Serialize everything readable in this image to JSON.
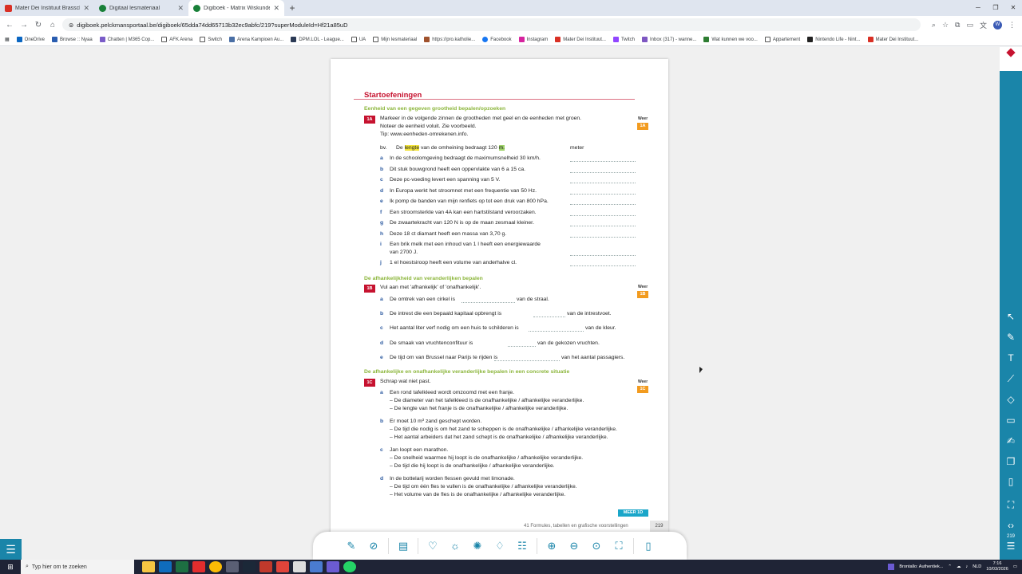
{
  "browser": {
    "tabs": [
      {
        "title": "Mater Dei Instituut Brasschaat",
        "color": "#d93025"
      },
      {
        "title": "Digitaal lesmateriaal",
        "color": "#188038"
      },
      {
        "title": "Digiboek - Matrix Wiskunde 3-4",
        "color": "#188038"
      }
    ],
    "url": "digiboek.pelckmansportaal.be/digiboek/65dda74dd65713b32ec9abfc/219?superModuleId=Hf21a85uD",
    "bookmarks": [
      "OneDrive",
      "Browse :: Nyaa",
      "Chatten | M365 Cop...",
      "AFK Arena",
      "Switch",
      "Arena Kampioen Au...",
      "DPM.LOL - League...",
      "UA",
      "Mijn lesmateriaal",
      "https://pro.katholie...",
      "Facebook",
      "Instagram",
      "Mater Dei Instituut...",
      "Twitch",
      "Inbox (317) - wanne...",
      "Wat kunnen we voo...",
      "Appartement",
      "Nintendo Life - Nint...",
      "Mater Dei Instituut..."
    ]
  },
  "doc": {
    "title": "Startoefeningen",
    "sectionA": "Eenheid van een gegeven grootheid bepalen/opzoeken",
    "tagA": "1A",
    "instrA": [
      "Markeer in de volgende zinnen de grootheden met geel en de eenheden met groen.",
      "Noteer de eenheid voluit. Zie voorbeeld.",
      "Tip: www.eenheden-omrekenen.info."
    ],
    "example": {
      "label": "bv.",
      "pre": "De ",
      "hl": "lengte",
      "mid": " van de omheining bedraagt 120 ",
      "unit": "m.",
      "answer": "meter"
    },
    "itemsA": [
      {
        "l": "a",
        "t": "In de schoolomgeving bedraagt de maximumsnelheid 30 km/h."
      },
      {
        "l": "b",
        "t": "Dit stuk bouwgrond heeft een oppervlakte van 6 a 15 ca."
      },
      {
        "l": "c",
        "t": "Deze pc-voeding levert een spanning van 5 V."
      },
      {
        "l": "d",
        "t": "In Europa werkt het stroomnet met een frequentie van 50 Hz."
      },
      {
        "l": "e",
        "t": "Ik pomp de banden van mijn renfiets op tot een druk van 800 hPa."
      },
      {
        "l": "f",
        "t": "Een stroomsterkte van 4A kan een hartstilstand veroorzaken."
      },
      {
        "l": "g",
        "t": "De zwaartekracht van 120 N is op de maan zesmaal kleiner."
      },
      {
        "l": "h",
        "t": "Deze 18 ct diamant heeft een massa van 3,70 g."
      },
      {
        "l": "i",
        "t": "Een brik melk met een inhoud van 1 l heeft een energiewaarde",
        "t2": "van 2700 J."
      },
      {
        "l": "j",
        "t": "1 el hoestsiroop heeft een volume van anderhalve cl."
      }
    ],
    "sectionB": "De afhankelijkheid van veranderlijken bepalen",
    "tagB": "1B",
    "instrB": "Vul aan met 'afhankelijk' of 'onafhankelijk'.",
    "itemsB": [
      {
        "l": "a",
        "pre": "De omtrek van een cirkel is",
        "post": "van de straal."
      },
      {
        "l": "b",
        "pre": "De intrest die een bepaald kapitaal opbrengt is",
        "post": "van de intrestvoet."
      },
      {
        "l": "c",
        "pre": "Het aantal liter verf nodig om een huis te schilderen is",
        "post": "van de kleur."
      },
      {
        "l": "d",
        "pre": "De smaak van vruchtenconfituur is",
        "post": "van de gekozen vruchten."
      },
      {
        "l": "e",
        "pre": "De tijd om van Brussel naar Parijs te rijden is",
        "post": "van het aantal passagiers."
      }
    ],
    "sectionC": "De afhankelijke en onafhankelijke veranderlijke bepalen in een concrete situatie",
    "tagC": "1C",
    "instrC": "Schrap wat niet past.",
    "itemsC": [
      {
        "l": "a",
        "t": "Een rond tafelkleed wordt omzoomd met een franje.",
        "s": [
          "– De diameter van het tafelkleed is de onafhankelijke / afhankelijke veranderlijke.",
          "– De lengte van het franje is de onafhankelijke / afhankelijke veranderlijke."
        ]
      },
      {
        "l": "b",
        "t": "Er moet 10 m³ zand geschept worden.",
        "s": [
          "– De tijd die nodig is om het zand te scheppen is de onafhankelijke / afhankelijke veranderlijke.",
          "– Het aantal arbeiders dat het zand schept is de onafhankelijke / afhankelijke veranderlijke."
        ]
      },
      {
        "l": "c",
        "t": "Jan loopt een marathon.",
        "s": [
          "– De snelheid waarmee hij loopt is de onafhankelijke / afhankelijke veranderlijke.",
          "– De tijd die hij loopt is de onafhankelijke / afhankelijke veranderlijke."
        ]
      },
      {
        "l": "d",
        "t": "In de bottelarij worden flessen gevuld met limonade.",
        "s": [
          "– De tijd om één fles te vullen is de onafhankelijke / afhankelijke veranderlijke.",
          "– Het volume van de fles is de onafhankelijke / afhankelijke veranderlijke."
        ]
      }
    ],
    "weer": "Weer",
    "meer": "MEER 1D",
    "footer": "41  Formules, tabellen en grafische voorstellingen",
    "pageNumber": "219"
  },
  "sidebar": {
    "page": "219"
  },
  "taskbar": {
    "search": "Typ hier om te zoeken",
    "media": "Brontallo: Authentiek...",
    "lang": "NLD",
    "time": "7:16",
    "date": "10/03/2026"
  }
}
